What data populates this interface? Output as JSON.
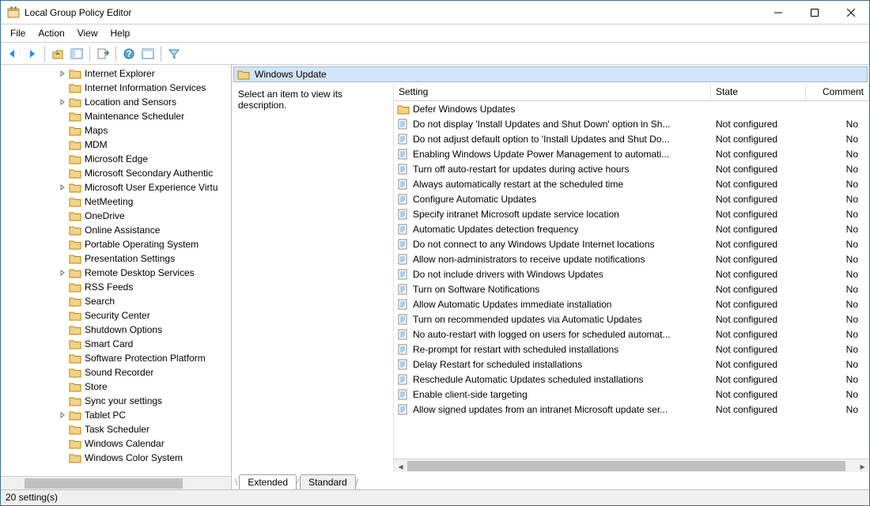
{
  "window": {
    "title": "Local Group Policy Editor"
  },
  "menu": {
    "items": [
      "File",
      "Action",
      "View",
      "Help"
    ]
  },
  "tree": {
    "items": [
      {
        "label": "Internet Explorer",
        "expandable": true
      },
      {
        "label": "Internet Information Services",
        "expandable": false
      },
      {
        "label": "Location and Sensors",
        "expandable": true
      },
      {
        "label": "Maintenance Scheduler",
        "expandable": false
      },
      {
        "label": "Maps",
        "expandable": false
      },
      {
        "label": "MDM",
        "expandable": false
      },
      {
        "label": "Microsoft Edge",
        "expandable": false
      },
      {
        "label": "Microsoft Secondary Authentic",
        "expandable": false
      },
      {
        "label": "Microsoft User Experience Virtu",
        "expandable": true
      },
      {
        "label": "NetMeeting",
        "expandable": false
      },
      {
        "label": "OneDrive",
        "expandable": false
      },
      {
        "label": "Online Assistance",
        "expandable": false
      },
      {
        "label": "Portable Operating System",
        "expandable": false
      },
      {
        "label": "Presentation Settings",
        "expandable": false
      },
      {
        "label": "Remote Desktop Services",
        "expandable": true
      },
      {
        "label": "RSS Feeds",
        "expandable": false
      },
      {
        "label": "Search",
        "expandable": false
      },
      {
        "label": "Security Center",
        "expandable": false
      },
      {
        "label": "Shutdown Options",
        "expandable": false
      },
      {
        "label": "Smart Card",
        "expandable": false
      },
      {
        "label": "Software Protection Platform",
        "expandable": false
      },
      {
        "label": "Sound Recorder",
        "expandable": false
      },
      {
        "label": "Store",
        "expandable": false
      },
      {
        "label": "Sync your settings",
        "expandable": false
      },
      {
        "label": "Tablet PC",
        "expandable": true
      },
      {
        "label": "Task Scheduler",
        "expandable": false
      },
      {
        "label": "Windows Calendar",
        "expandable": false
      },
      {
        "label": "Windows Color System",
        "expandable": false
      }
    ]
  },
  "detail": {
    "path_title": "Windows Update",
    "description": "Select an item to view its description.",
    "columns": {
      "setting": "Setting",
      "state": "State",
      "comment": "Comment"
    },
    "rows": [
      {
        "type": "folder",
        "setting": "Defer Windows Updates",
        "state": "",
        "comment": ""
      },
      {
        "type": "policy",
        "setting": "Do not display 'Install Updates and Shut Down' option in Sh...",
        "state": "Not configured",
        "comment": "No"
      },
      {
        "type": "policy",
        "setting": "Do not adjust default option to 'Install Updates and Shut Do...",
        "state": "Not configured",
        "comment": "No"
      },
      {
        "type": "policy",
        "setting": "Enabling Windows Update Power Management to automati...",
        "state": "Not configured",
        "comment": "No"
      },
      {
        "type": "policy",
        "setting": "Turn off auto-restart for updates during active hours",
        "state": "Not configured",
        "comment": "No"
      },
      {
        "type": "policy",
        "setting": "Always automatically restart at the scheduled time",
        "state": "Not configured",
        "comment": "No"
      },
      {
        "type": "policy",
        "setting": "Configure Automatic Updates",
        "state": "Not configured",
        "comment": "No"
      },
      {
        "type": "policy",
        "setting": "Specify intranet Microsoft update service location",
        "state": "Not configured",
        "comment": "No"
      },
      {
        "type": "policy",
        "setting": "Automatic Updates detection frequency",
        "state": "Not configured",
        "comment": "No"
      },
      {
        "type": "policy",
        "setting": "Do not connect to any Windows Update Internet locations",
        "state": "Not configured",
        "comment": "No"
      },
      {
        "type": "policy",
        "setting": "Allow non-administrators to receive update notifications",
        "state": "Not configured",
        "comment": "No"
      },
      {
        "type": "policy",
        "setting": "Do not include drivers with Windows Updates",
        "state": "Not configured",
        "comment": "No"
      },
      {
        "type": "policy",
        "setting": "Turn on Software Notifications",
        "state": "Not configured",
        "comment": "No"
      },
      {
        "type": "policy",
        "setting": "Allow Automatic Updates immediate installation",
        "state": "Not configured",
        "comment": "No"
      },
      {
        "type": "policy",
        "setting": "Turn on recommended updates via Automatic Updates",
        "state": "Not configured",
        "comment": "No"
      },
      {
        "type": "policy",
        "setting": "No auto-restart with logged on users for scheduled automat...",
        "state": "Not configured",
        "comment": "No"
      },
      {
        "type": "policy",
        "setting": "Re-prompt for restart with scheduled installations",
        "state": "Not configured",
        "comment": "No"
      },
      {
        "type": "policy",
        "setting": "Delay Restart for scheduled installations",
        "state": "Not configured",
        "comment": "No"
      },
      {
        "type": "policy",
        "setting": "Reschedule Automatic Updates scheduled installations",
        "state": "Not configured",
        "comment": "No"
      },
      {
        "type": "policy",
        "setting": "Enable client-side targeting",
        "state": "Not configured",
        "comment": "No"
      },
      {
        "type": "policy",
        "setting": "Allow signed updates from an intranet Microsoft update ser...",
        "state": "Not configured",
        "comment": "No"
      }
    ]
  },
  "tabs": {
    "extended": "Extended",
    "standard": "Standard"
  },
  "status": {
    "text": "20 setting(s)"
  }
}
